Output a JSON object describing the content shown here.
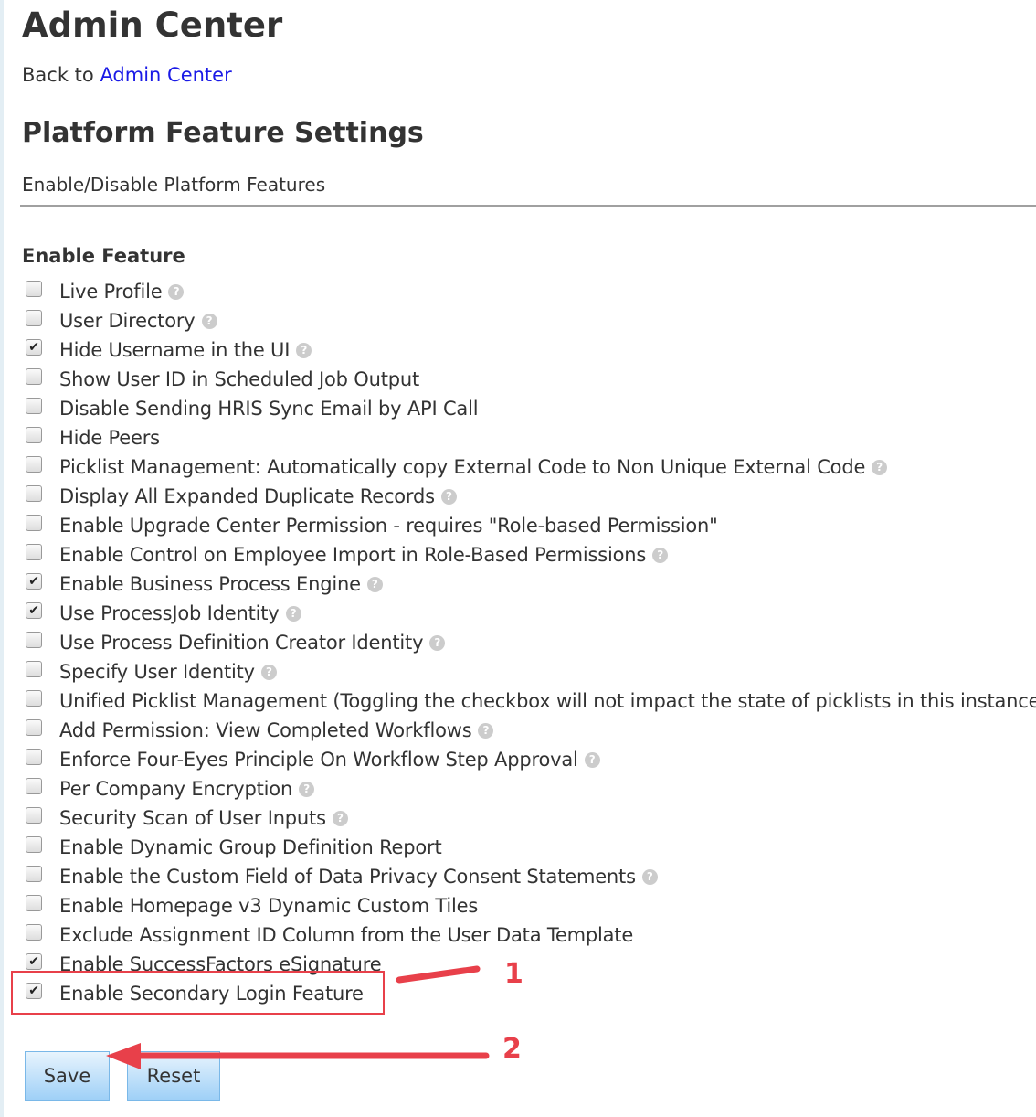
{
  "header": {
    "title": "Admin Center",
    "back_prefix": "Back to",
    "back_link": "Admin Center"
  },
  "section": {
    "title": "Platform Feature Settings",
    "subtitle": "Enable/Disable Platform Features",
    "group_label": "Enable Feature"
  },
  "features": [
    {
      "label": "Live Profile",
      "checked": false,
      "help": true
    },
    {
      "label": "User Directory",
      "checked": false,
      "help": true
    },
    {
      "label": "Hide Username in the UI",
      "checked": true,
      "help": true
    },
    {
      "label": "Show User ID in Scheduled Job Output",
      "checked": false,
      "help": false
    },
    {
      "label": "Disable Sending HRIS Sync Email by API Call",
      "checked": false,
      "help": false
    },
    {
      "label": "Hide Peers",
      "checked": false,
      "help": false
    },
    {
      "label": "Picklist Management: Automatically copy External Code to Non Unique External Code",
      "checked": false,
      "help": true
    },
    {
      "label": "Display All Expanded Duplicate Records",
      "checked": false,
      "help": true
    },
    {
      "label": "Enable Upgrade Center Permission - requires \"Role-based Permission\"",
      "checked": false,
      "help": false
    },
    {
      "label": "Enable Control on Employee Import in Role-Based Permissions",
      "checked": false,
      "help": true
    },
    {
      "label": "Enable Business Process Engine",
      "checked": true,
      "help": true
    },
    {
      "label": "Use ProcessJob Identity",
      "checked": true,
      "help": true
    },
    {
      "label": "Use Process Definition Creator Identity",
      "checked": false,
      "help": true
    },
    {
      "label": "Specify User Identity",
      "checked": false,
      "help": true
    },
    {
      "label": "Unified Picklist Management (Toggling the checkbox will not impact the state of picklists in this instance.)",
      "checked": false,
      "help": false
    },
    {
      "label": "Add Permission: View Completed Workflows",
      "checked": false,
      "help": true
    },
    {
      "label": "Enforce Four-Eyes Principle On Workflow Step Approval",
      "checked": false,
      "help": true
    },
    {
      "label": "Per Company Encryption",
      "checked": false,
      "help": true
    },
    {
      "label": "Security Scan of User Inputs",
      "checked": false,
      "help": true
    },
    {
      "label": "Enable Dynamic Group Definition Report",
      "checked": false,
      "help": false
    },
    {
      "label": "Enable the Custom Field of Data Privacy Consent Statements",
      "checked": false,
      "help": true
    },
    {
      "label": "Enable Homepage v3 Dynamic Custom Tiles",
      "checked": false,
      "help": false
    },
    {
      "label": "Exclude Assignment ID Column from the User Data Template",
      "checked": false,
      "help": false
    },
    {
      "label": "Enable SuccessFactors eSignature",
      "checked": true,
      "help": false
    },
    {
      "label": "Enable Secondary Login Feature",
      "checked": true,
      "help": false
    }
  ],
  "buttons": {
    "save": "Save",
    "reset": "Reset"
  },
  "annotations": {
    "step1": "1",
    "step2": "2",
    "color": "#e8404a"
  }
}
